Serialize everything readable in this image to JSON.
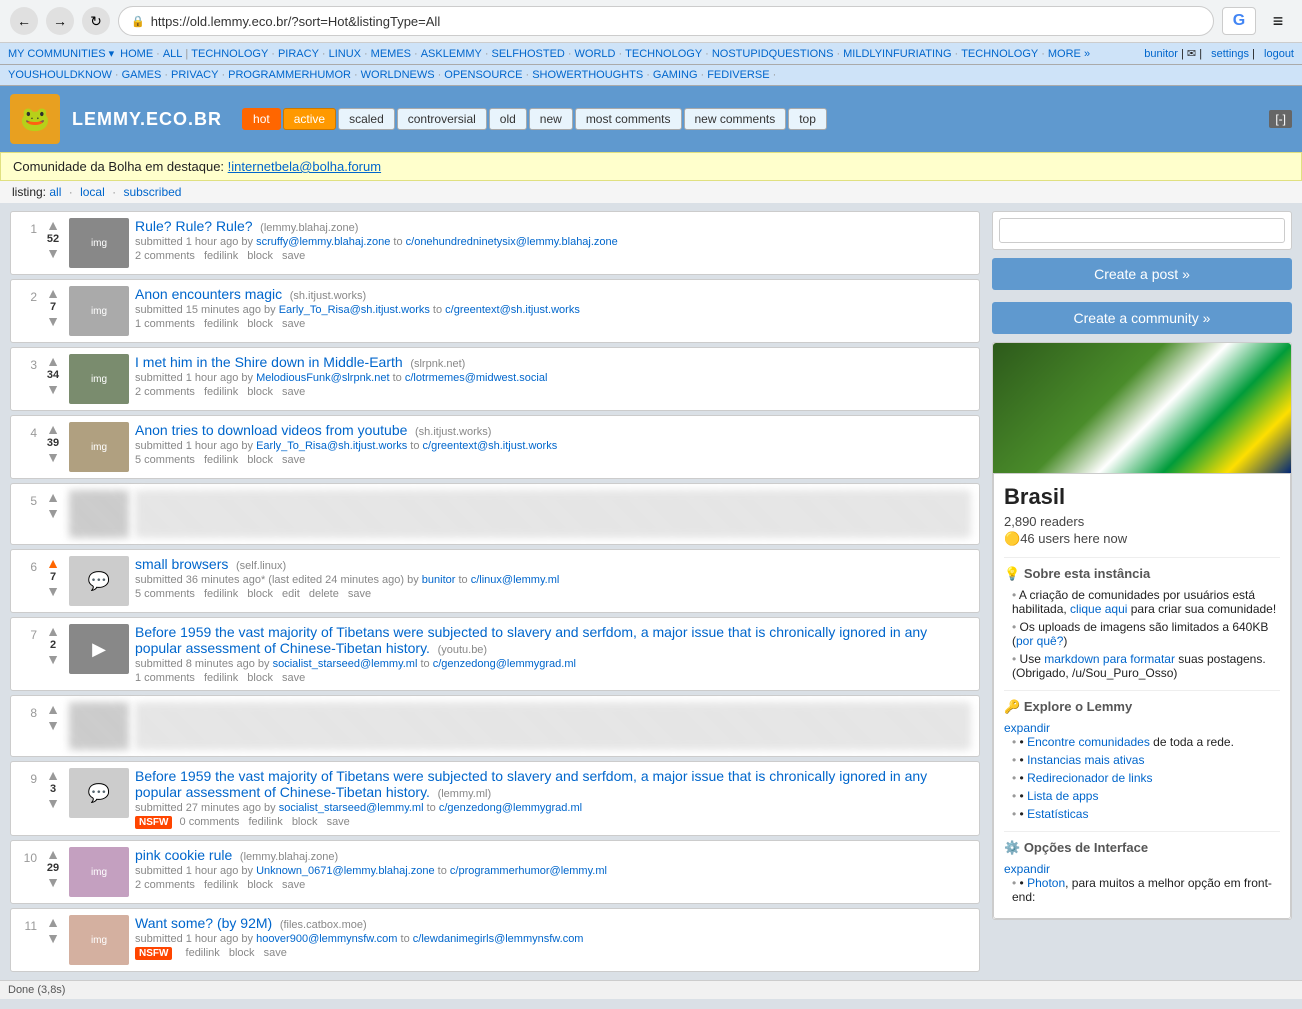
{
  "browser": {
    "back_btn": "←",
    "fwd_btn": "→",
    "refresh_btn": "↻",
    "url": "https://old.lemmy.eco.br/?sort=Hot&listingType=All",
    "search_placeholder": "",
    "menu_btn": "≡"
  },
  "top_nav": {
    "items": [
      {
        "label": "MY COMMUNITIES ▾",
        "href": "#"
      },
      {
        "label": "HOME",
        "href": "#"
      },
      {
        "label": "ALL",
        "href": "#"
      },
      {
        "label": "TECHNOLOGY",
        "href": "#"
      },
      {
        "label": "PIRACY",
        "href": "#"
      },
      {
        "label": "LINUX",
        "href": "#"
      },
      {
        "label": "MEMES",
        "href": "#"
      },
      {
        "label": "ASKLEMMY",
        "href": "#"
      },
      {
        "label": "SELFHOSTED",
        "href": "#"
      },
      {
        "label": "WORLD",
        "href": "#"
      },
      {
        "label": "TECHNOLOGY",
        "href": "#"
      },
      {
        "label": "NOSTUPIDQUESTIONS",
        "href": "#"
      },
      {
        "label": "MILDLYINFURIATING",
        "href": "#"
      },
      {
        "label": "TECHNOLOGY",
        "href": "#"
      },
      {
        "label": "MORE »",
        "href": "#"
      },
      {
        "label": "YOUSHOULDKNOW",
        "href": "#"
      },
      {
        "label": "GAMES",
        "href": "#"
      },
      {
        "label": "PRIVACY",
        "href": "#"
      },
      {
        "label": "PROGRAMMERHUMOR",
        "href": "#"
      },
      {
        "label": "WORLDNEWS",
        "href": "#"
      },
      {
        "label": "OPENSOURCE",
        "href": "#"
      },
      {
        "label": "SHOWERTHOUGHTS",
        "href": "#"
      },
      {
        "label": "GAMING",
        "href": "#"
      },
      {
        "label": "FEDIVERSE",
        "href": "#"
      }
    ],
    "user": "bunitor",
    "settings": "settings",
    "logout": "logout"
  },
  "site_header": {
    "logo_emoji": "🐸",
    "site_name": "LEMMY.ECO.BR",
    "sort_tabs": [
      {
        "label": "hot",
        "active": true
      },
      {
        "label": "active",
        "active_sort": true
      },
      {
        "label": "scaled"
      },
      {
        "label": "controversial"
      },
      {
        "label": "old"
      },
      {
        "label": "new"
      },
      {
        "label": "most comments"
      },
      {
        "label": "new comments"
      },
      {
        "label": "top"
      }
    ],
    "collapse_btn": "[-]"
  },
  "featured_bar": {
    "prefix": "Comunidade da Bolha em destaque:",
    "link_text": "!internetbela@bolha.forum",
    "link_href": "#"
  },
  "listing": {
    "label": "listing:",
    "options": [
      {
        "label": "all",
        "href": "#"
      },
      {
        "label": "local",
        "href": "#"
      },
      {
        "label": "subscribed",
        "href": "#"
      }
    ]
  },
  "posts": [
    {
      "rank": "1",
      "score": "52",
      "up_active": false,
      "down_active": false,
      "thumb_color": "#999",
      "title": "Rule? Rule? Rule?",
      "domain": "(lemmy.blahaj.zone)",
      "meta": "submitted 1 hour ago by",
      "author": "scruffy@lemmy.blahaj.zone",
      "to": "to",
      "community": "c/onehundredninetysix@lemmy.blahaj.zone",
      "comments": "2 comments",
      "actions": [
        "fedilink",
        "block",
        "save"
      ],
      "blurred": false,
      "nsfw": false
    },
    {
      "rank": "2",
      "score": "7",
      "up_active": false,
      "down_active": false,
      "title": "Anon encounters magic",
      "domain": "(sh.itjust.works)",
      "meta": "submitted 15 minutes ago by",
      "author": "Early_To_Risa@sh.itjust.works",
      "to": "to",
      "community": "c/greentext@sh.itjust.works",
      "comments": "1 comments",
      "actions": [
        "fedilink",
        "block",
        "save"
      ],
      "blurred": false,
      "nsfw": false
    },
    {
      "rank": "3",
      "score": "34",
      "up_active": false,
      "down_active": false,
      "title": "I met him in the Shire down in Middle-Earth",
      "domain": "(slrpnk.net)",
      "meta": "submitted 1 hour ago by",
      "author": "MelodiousFunk@slrpnk.net",
      "to": "to",
      "community": "c/lotrmemes@midwest.social",
      "comments": "2 comments",
      "actions": [
        "fedilink",
        "block",
        "save"
      ],
      "blurred": false,
      "nsfw": false
    },
    {
      "rank": "4",
      "score": "39",
      "up_active": false,
      "down_active": false,
      "title": "Anon tries to download videos from youtube",
      "domain": "(sh.itjust.works)",
      "meta": "submitted 1 hour ago by",
      "author": "Early_To_Risa@sh.itjust.works",
      "to": "to",
      "community": "c/greentext@sh.itjust.works",
      "comments": "5 comments",
      "actions": [
        "fedilink",
        "block",
        "save"
      ],
      "blurred": false,
      "nsfw": false
    },
    {
      "rank": "5",
      "score": "",
      "blurred": true,
      "nsfw": false,
      "title": "",
      "actions": []
    },
    {
      "rank": "6",
      "score": "7",
      "up_active": true,
      "down_active": false,
      "title": "small browsers",
      "domain": "(self.linux)",
      "meta": "submitted 36 minutes ago* (last edited 24 minutes ago) by",
      "author": "bunitor",
      "to": "to",
      "community": "c/linux@lemmy.ml",
      "comments": "5 comments",
      "actions": [
        "fedilink",
        "block",
        "edit",
        "delete",
        "save"
      ],
      "blurred": false,
      "nsfw": false
    },
    {
      "rank": "7",
      "score": "2",
      "up_active": false,
      "down_active": false,
      "title": "Before 1959 the vast majority of Tibetans were subjected to slavery and serfdom, a major issue that is chronically ignored in any popular assessment of Chinese-Tibetan history.",
      "domain": "(youtu.be)",
      "meta": "submitted 8 minutes ago by",
      "author": "socialist_starseed@lemmy.ml",
      "to": "to",
      "community": "c/genzedong@lemmygrad.ml",
      "comments": "1 comments",
      "actions": [
        "fedilink",
        "block",
        "save"
      ],
      "blurred": false,
      "nsfw": false
    },
    {
      "rank": "8",
      "score": "",
      "blurred": true,
      "nsfw": false,
      "title": "",
      "actions": []
    },
    {
      "rank": "9",
      "score": "3",
      "up_active": false,
      "down_active": false,
      "title": "Before 1959 the vast majority of Tibetans were subjected to slavery and serfdom, a major issue that is chronically ignored in any popular assessment of Chinese-Tibetan history.",
      "domain": "(lemmy.ml)",
      "meta": "submitted 27 minutes ago by",
      "author": "socialist_starseed@lemmy.ml",
      "to": "to",
      "community": "c/genzedong@lemmygrad.ml",
      "comments": "0 comments",
      "actions": [
        "fedilink",
        "block",
        "save"
      ],
      "blurred": false,
      "nsfw": true
    },
    {
      "rank": "10",
      "score": "29",
      "up_active": false,
      "down_active": false,
      "title": "pink cookie rule",
      "domain": "(lemmy.blahaj.zone)",
      "meta": "submitted 1 hour ago by",
      "author": "Unknown_0671@lemmy.blahaj.zone",
      "to": "to",
      "community": "c/programmerhumor@lemmy.ml",
      "comments": "2 comments",
      "actions": [
        "fedilink",
        "block",
        "save"
      ],
      "blurred": false,
      "nsfw": false
    },
    {
      "rank": "11",
      "score": "",
      "up_active": false,
      "down_active": false,
      "title": "Want some? (by 92M)",
      "domain": "(files.catbox.moe)",
      "meta": "submitted 1 hour ago by",
      "author": "hoover900@lemmynsfw.com",
      "to": "to",
      "community": "c/lewdanimegirls@lemmynsfw.com",
      "comments": "",
      "actions": [
        "fedilink",
        "block",
        "save"
      ],
      "blurred": false,
      "nsfw": false
    }
  ],
  "sidebar": {
    "search_placeholder": "",
    "create_post_btn": "Create a post »",
    "create_community_btn": "Create a community »",
    "community_name": "Brasil",
    "readers": "2,890 readers",
    "users_online": "46 users here now",
    "about_title": "Sobre esta instância",
    "about_icon": "💡",
    "about_items": [
      {
        "text": "A criação de comunidades por usuários está habilitada,",
        "link": "clique aqui",
        "suffix": " para criar sua comunidade!"
      },
      {
        "text": "Os uploads de imagens são limitados a 640KB (",
        "link": "por quê?",
        "suffix": ")"
      },
      {
        "text": "Use ",
        "link": "markdown para formatar",
        "suffix": " suas postagens. (Obrigado, /u/Sou_Puro_Osso)"
      }
    ],
    "explore_title": "Explore o Lemmy",
    "explore_icon": "🔑",
    "explore_expand": "expandir",
    "explore_items": [
      {
        "text": "Encontre comunidades",
        "link": "Encontre comunidades",
        "suffix": " de toda a rede."
      },
      {
        "text": "Instancias mais ativas",
        "link": "Instancias mais ativas"
      },
      {
        "text": "Redirecionador de links",
        "link": "Redirecionador de links"
      },
      {
        "text": "Lista de apps",
        "link": "Lista de apps"
      },
      {
        "text": "Estatísticas",
        "link": "Estatísticas"
      }
    ],
    "interface_title": "Opções de Interface",
    "interface_icon": "⚙️",
    "interface_expand": "expandir",
    "interface_items": [
      {
        "text": "Photon",
        "link": "Photon",
        "suffix": ", para muitos a melhor opção em front-end:"
      }
    ]
  },
  "status_bar": {
    "text": "Done (3,8s)"
  }
}
